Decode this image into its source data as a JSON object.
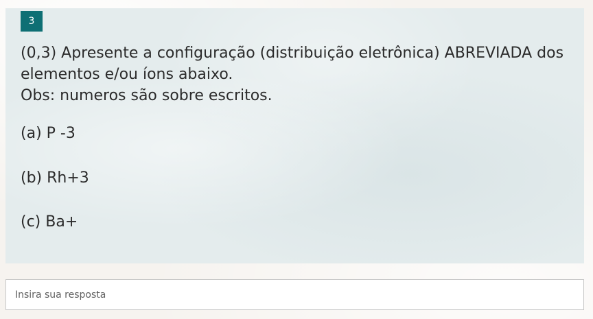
{
  "question": {
    "number": "3",
    "lines": [
      "(0,3) Apresente a configuração (distribuição eletrônica) ABREVIADA dos",
      "elementos e/ou íons abaixo.",
      "Obs:  numeros são sobre escritos."
    ],
    "options": [
      "(a) P -3",
      "(b) Rh+3",
      "(c) Ba+"
    ]
  },
  "answer": {
    "placeholder": "Insira sua resposta",
    "value": ""
  },
  "colors": {
    "accent": "#0e6f74",
    "card_background": "#e4eced"
  }
}
